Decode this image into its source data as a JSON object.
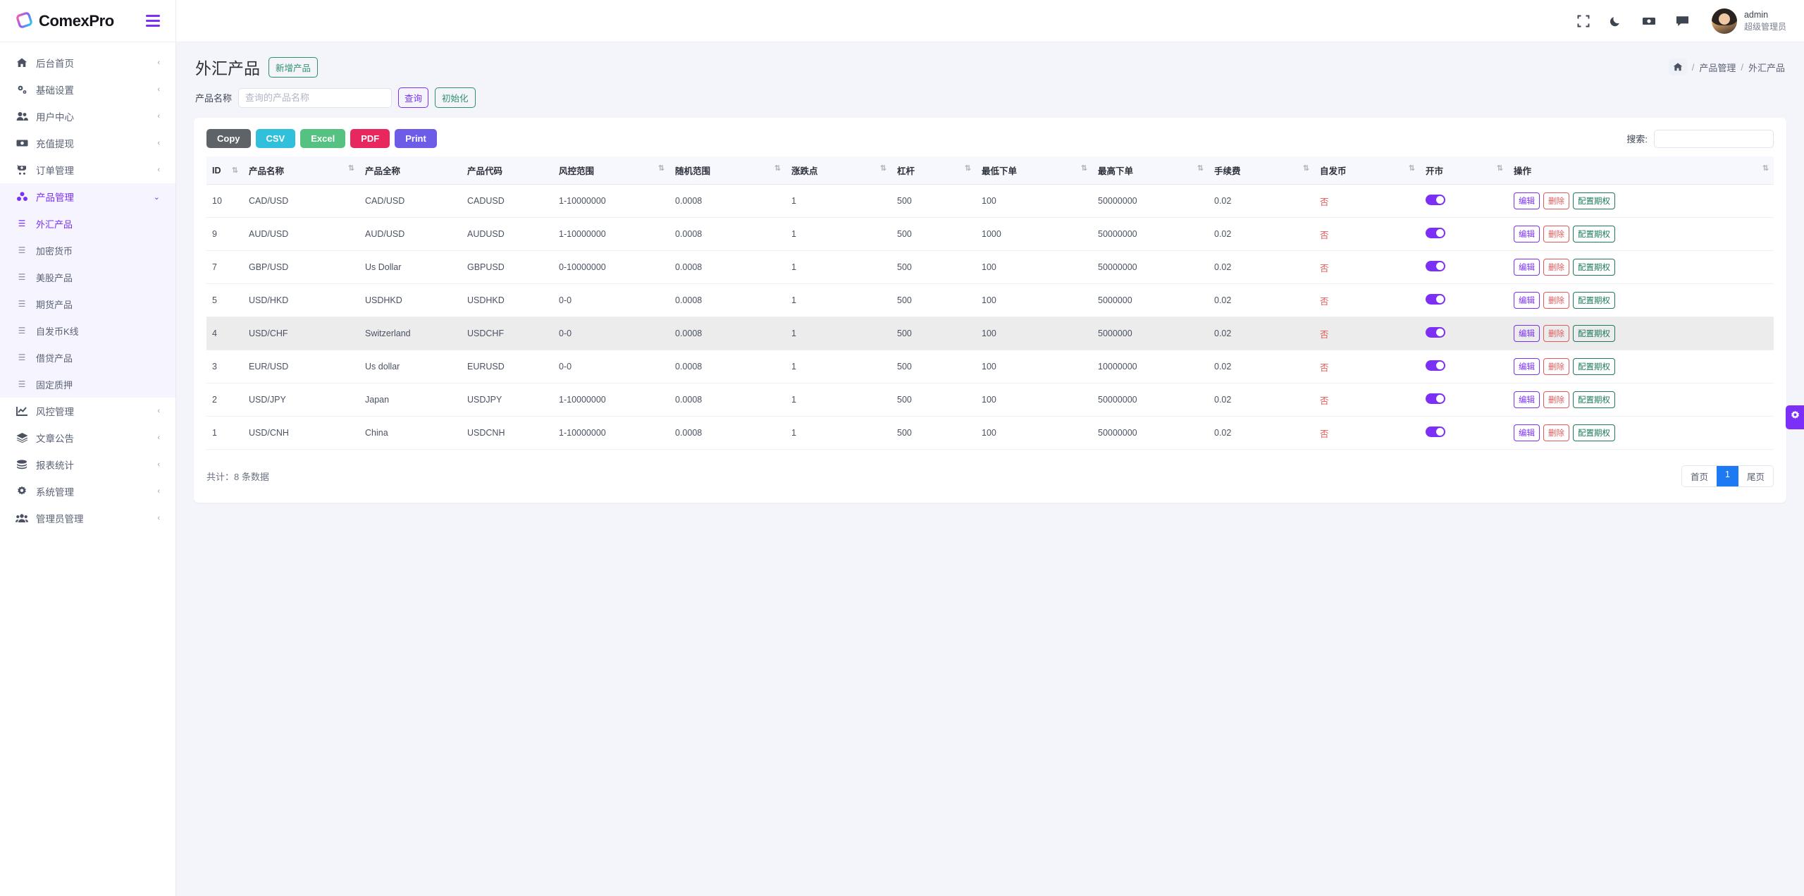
{
  "brand": {
    "name": "ComexPro",
    "logo_icon": "comexpro-logo",
    "menu_icon": "hamburger-icon"
  },
  "sidebar": {
    "items": [
      {
        "label": "后台首页",
        "icon": "home-icon",
        "caret": "‹"
      },
      {
        "label": "基础设置",
        "icon": "gears-icon",
        "caret": "‹"
      },
      {
        "label": "用户中心",
        "icon": "users-icon",
        "caret": "‹"
      },
      {
        "label": "充值提现",
        "icon": "money-icon",
        "caret": "‹"
      },
      {
        "label": "订单管理",
        "icon": "cart-icon",
        "caret": "‹"
      },
      {
        "label": "产品管理",
        "icon": "cubes-icon",
        "caret": "⌄",
        "active": true
      },
      {
        "label": "风控管理",
        "icon": "chart-line-icon",
        "caret": "‹"
      },
      {
        "label": "文章公告",
        "icon": "layers-icon",
        "caret": "‹"
      },
      {
        "label": "报表统计",
        "icon": "coins-icon",
        "caret": "‹"
      },
      {
        "label": "系统管理",
        "icon": "gear-icon",
        "caret": "‹"
      },
      {
        "label": "管理员管理",
        "icon": "user-group-icon",
        "caret": "‹"
      }
    ],
    "submenu": [
      {
        "label": "外汇产品",
        "current": true
      },
      {
        "label": "加密货币"
      },
      {
        "label": "美股产品"
      },
      {
        "label": "期货产品"
      },
      {
        "label": "自发币K线"
      },
      {
        "label": "借贷产品"
      },
      {
        "label": "固定质押"
      }
    ]
  },
  "topbar": {
    "icons": [
      "fullscreen-icon",
      "moon-icon",
      "cash-icon",
      "chat-icon"
    ],
    "user": {
      "name": "admin",
      "role": "超级管理员",
      "avatar": "user-avatar"
    }
  },
  "page": {
    "title": "外汇产品",
    "add_button": "新增产品",
    "breadcrumb": {
      "home_icon": "home-icon",
      "sep": "/",
      "items": [
        "产品管理",
        "外汇产品"
      ]
    }
  },
  "filter": {
    "label": "产品名称",
    "placeholder": "查询的产品名称",
    "value": "",
    "query_button": "查询",
    "reset_button": "初始化"
  },
  "toolbar": {
    "export": [
      {
        "label": "Copy",
        "color": "#5e6367"
      },
      {
        "label": "CSV",
        "color": "#30c0dc"
      },
      {
        "label": "Excel",
        "color": "#56c282"
      },
      {
        "label": "PDF",
        "color": "#e8275e"
      },
      {
        "label": "Print",
        "color": "#6c5ce7"
      }
    ],
    "search_label": "搜索:",
    "search_value": "",
    "sort_icon": "sort-icon"
  },
  "table": {
    "columns": [
      {
        "key": "id",
        "label": "ID",
        "sortable": true
      },
      {
        "key": "name",
        "label": "产品名称",
        "sortable": true
      },
      {
        "key": "fullname",
        "label": "产品全称",
        "sortable": false
      },
      {
        "key": "code",
        "label": "产品代码",
        "sortable": false
      },
      {
        "key": "risk_range",
        "label": "风控范围",
        "sortable": true
      },
      {
        "key": "random_range",
        "label": "随机范围",
        "sortable": true
      },
      {
        "key": "tick",
        "label": "涨跌点",
        "sortable": true
      },
      {
        "key": "leverage",
        "label": "杠杆",
        "sortable": true
      },
      {
        "key": "min_order",
        "label": "最低下单",
        "sortable": true
      },
      {
        "key": "max_order",
        "label": "最高下单",
        "sortable": true
      },
      {
        "key": "fee",
        "label": "手续费",
        "sortable": true
      },
      {
        "key": "self_coin",
        "label": "自发币",
        "sortable": true
      },
      {
        "key": "open",
        "label": "开市",
        "sortable": true
      },
      {
        "key": "ops",
        "label": "操作",
        "sortable": true
      }
    ],
    "rows": [
      {
        "id": "10",
        "name": "CAD/USD",
        "fullname": "CAD/USD",
        "code": "CADUSD",
        "risk_range": "1-10000000",
        "random_range": "0.0008",
        "tick": "1",
        "leverage": "500",
        "min_order": "100",
        "max_order": "50000000",
        "fee": "0.02",
        "self_coin": "否",
        "open": true,
        "highlight": false
      },
      {
        "id": "9",
        "name": "AUD/USD",
        "fullname": "AUD/USD",
        "code": "AUDUSD",
        "risk_range": "1-10000000",
        "random_range": "0.0008",
        "tick": "1",
        "leverage": "500",
        "min_order": "1000",
        "max_order": "50000000",
        "fee": "0.02",
        "self_coin": "否",
        "open": true,
        "highlight": false
      },
      {
        "id": "7",
        "name": "GBP/USD",
        "fullname": "Us Dollar",
        "code": "GBPUSD",
        "risk_range": "0-10000000",
        "random_range": "0.0008",
        "tick": "1",
        "leverage": "500",
        "min_order": "100",
        "max_order": "50000000",
        "fee": "0.02",
        "self_coin": "否",
        "open": true,
        "highlight": false
      },
      {
        "id": "5",
        "name": "USD/HKD",
        "fullname": "USDHKD",
        "code": "USDHKD",
        "risk_range": "0-0",
        "random_range": "0.0008",
        "tick": "1",
        "leverage": "500",
        "min_order": "100",
        "max_order": "5000000",
        "fee": "0.02",
        "self_coin": "否",
        "open": true,
        "highlight": false
      },
      {
        "id": "4",
        "name": "USD/CHF",
        "fullname": "Switzerland",
        "code": "USDCHF",
        "risk_range": "0-0",
        "random_range": "0.0008",
        "tick": "1",
        "leverage": "500",
        "min_order": "100",
        "max_order": "5000000",
        "fee": "0.02",
        "self_coin": "否",
        "open": true,
        "highlight": true
      },
      {
        "id": "3",
        "name": "EUR/USD",
        "fullname": "Us dollar",
        "code": "EURUSD",
        "risk_range": "0-0",
        "random_range": "0.0008",
        "tick": "1",
        "leverage": "500",
        "min_order": "100",
        "max_order": "10000000",
        "fee": "0.02",
        "self_coin": "否",
        "open": true,
        "highlight": false
      },
      {
        "id": "2",
        "name": "USD/JPY",
        "fullname": "Japan",
        "code": "USDJPY",
        "risk_range": "1-10000000",
        "random_range": "0.0008",
        "tick": "1",
        "leverage": "500",
        "min_order": "100",
        "max_order": "50000000",
        "fee": "0.02",
        "self_coin": "否",
        "open": true,
        "highlight": false
      },
      {
        "id": "1",
        "name": "USD/CNH",
        "fullname": "China",
        "code": "USDCNH",
        "risk_range": "1-10000000",
        "random_range": "0.0008",
        "tick": "1",
        "leverage": "500",
        "min_order": "100",
        "max_order": "50000000",
        "fee": "0.02",
        "self_coin": "否",
        "open": true,
        "highlight": false
      }
    ],
    "row_ops": {
      "edit": "编辑",
      "delete": "删除",
      "config": "配置期权"
    }
  },
  "footer": {
    "total": "共计：8 条数据",
    "pager": {
      "first": "首页",
      "current": "1",
      "last": "尾页"
    }
  },
  "fab": {
    "icon": "gear-icon"
  },
  "colors": {
    "accent": "#7b2ff7",
    "page_bg": "#f4f5fb",
    "active_row": "#ececed",
    "pager_active": "#1d7af3"
  }
}
